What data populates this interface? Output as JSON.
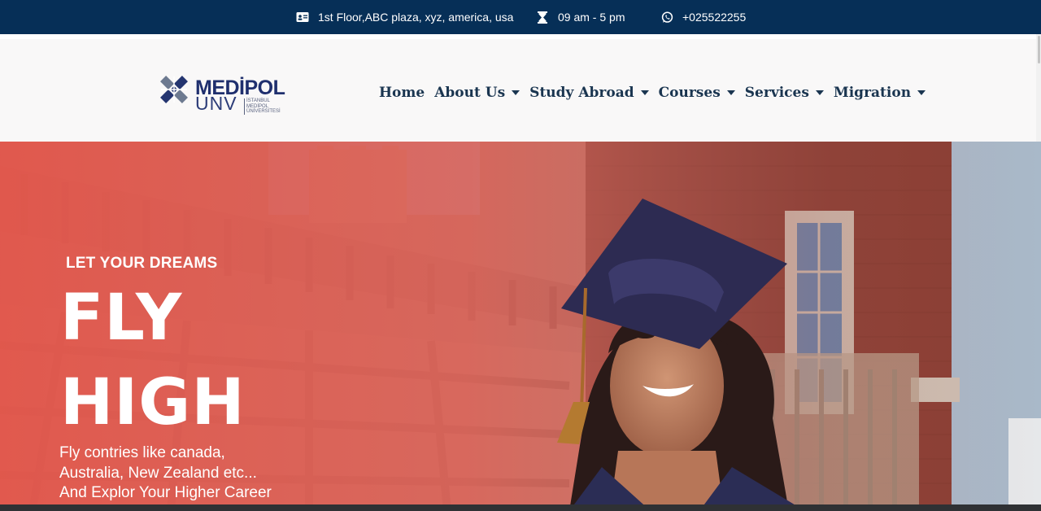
{
  "topbar": {
    "address": "1st Floor,ABC plaza, xyz, america, usa",
    "hours": "09 am - 5 pm",
    "phone": "+025522255",
    "background": "#062f57"
  },
  "brand": {
    "name": "MEDİPOL",
    "sub_name": "UNV",
    "tagline_lines": [
      "İSTANBUL",
      "MEDİPOL",
      "ÜNİVERSİTESİ"
    ],
    "logo_icon": "medipol-logo-icon"
  },
  "nav": {
    "items": [
      {
        "label": "Home",
        "dropdown": false
      },
      {
        "label": "About Us",
        "dropdown": true
      },
      {
        "label": "Study Abroad",
        "dropdown": true
      },
      {
        "label": "Courses",
        "dropdown": true
      },
      {
        "label": "Services",
        "dropdown": true
      },
      {
        "label": "Migration",
        "dropdown": true
      }
    ],
    "text_color": "#1a3550"
  },
  "hero": {
    "eyebrow": "LET YOUR DREAMS",
    "headline_1": "FLY",
    "headline_2": "HIGH",
    "description_lines": [
      "Fly contries like canada,",
      "Australia, New Zealand etc...",
      "And Explor Your Higher Career"
    ],
    "overlay_color": "#e2574c"
  }
}
